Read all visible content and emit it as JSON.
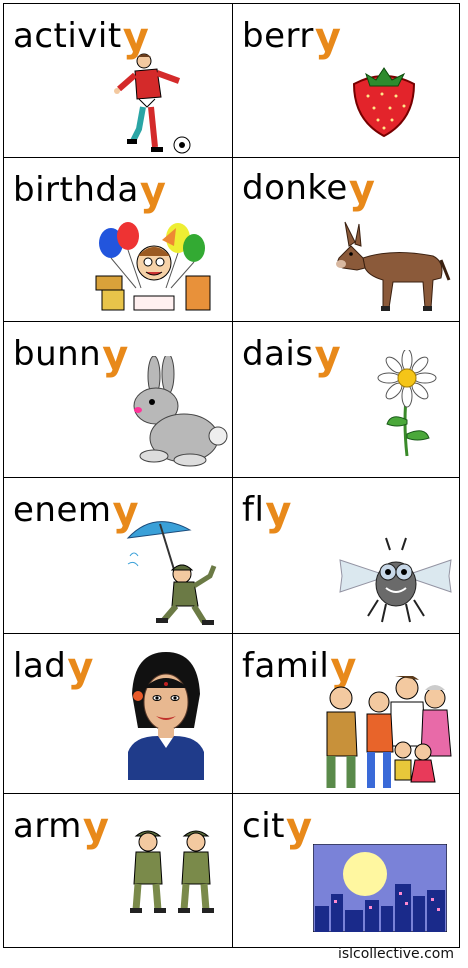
{
  "cards": [
    {
      "stem": "activit",
      "ending": "y",
      "picture": "boy-kicking-ball"
    },
    {
      "stem": "berr",
      "ending": "y",
      "picture": "strawberry"
    },
    {
      "stem": "birthda",
      "ending": "y",
      "picture": "birthday-boy"
    },
    {
      "stem": "donke",
      "ending": "y",
      "picture": "donkey"
    },
    {
      "stem": "bunn",
      "ending": "y",
      "picture": "rabbit"
    },
    {
      "stem": "dais",
      "ending": "y",
      "picture": "daisy-flower"
    },
    {
      "stem": "enem",
      "ending": "y",
      "picture": "soldier-with-umbrella"
    },
    {
      "stem": "fl",
      "ending": "y",
      "picture": "fly-insect"
    },
    {
      "stem": "lad",
      "ending": "y",
      "picture": "woman-portrait"
    },
    {
      "stem": "famil",
      "ending": "y",
      "picture": "family-group"
    },
    {
      "stem": "arm",
      "ending": "y",
      "picture": "two-soldiers"
    },
    {
      "stem": "cit",
      "ending": "y",
      "picture": "city-skyline"
    }
  ],
  "footer": {
    "watermark": "islcollective.com"
  },
  "colors": {
    "ending": "#e8891a",
    "text": "#000000",
    "border": "#000000"
  }
}
